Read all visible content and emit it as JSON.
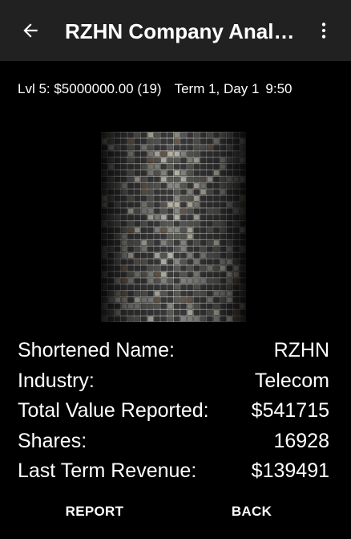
{
  "toolbar": {
    "title": "RZHN Company Analy…",
    "back_icon": "arrow-left-icon",
    "menu_icon": "more-vert-icon"
  },
  "status": {
    "level": "Lvl 5: $5000000.00 (19)",
    "term": "Term 1, Day 1",
    "time": "9:50"
  },
  "company": {
    "rows": [
      {
        "label": "Shortened Name:",
        "value": "RZHN"
      },
      {
        "label": "Industry:",
        "value": "Telecom"
      },
      {
        "label": "Total Value Reported:",
        "value": "$541715"
      },
      {
        "label": "Shares:",
        "value": "16928"
      },
      {
        "label": "Last Term Revenue:",
        "value": "$139491"
      }
    ]
  },
  "actions": {
    "report_label": "REPORT",
    "back_label": "BACK"
  },
  "colors": {
    "toolbar_bg": "#212121",
    "page_bg": "#000000",
    "text": "#ffffff"
  }
}
